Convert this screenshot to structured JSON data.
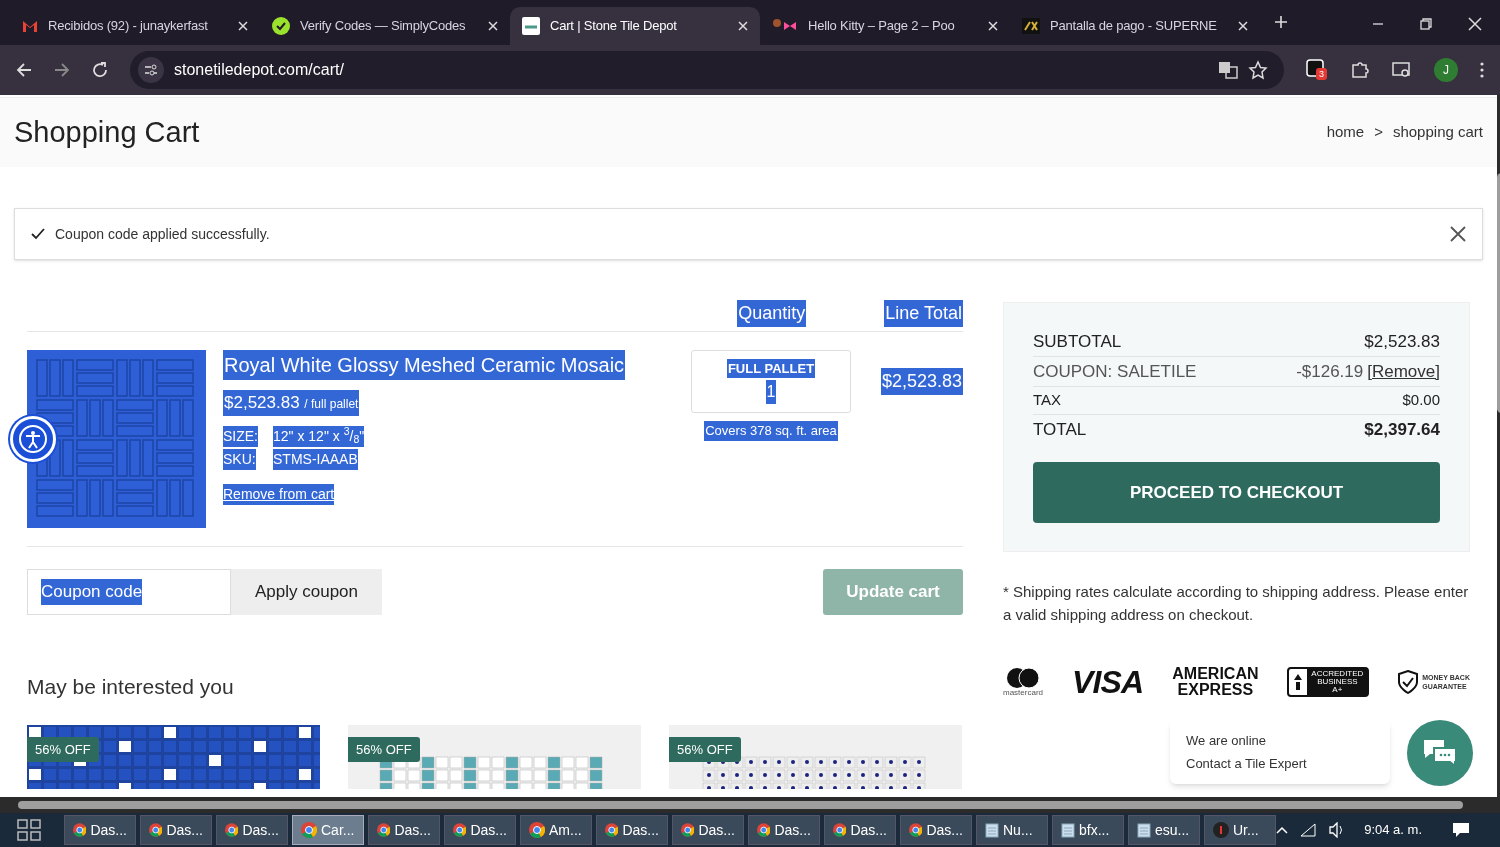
{
  "browser": {
    "tabs": [
      {
        "kind": "mail",
        "title": "Recibidos (92) - junaykerfast",
        "selected": false
      },
      {
        "kind": "check",
        "title": "Verify Codes — SimplyCodes",
        "selected": false
      },
      {
        "kind": "std",
        "title": "Cart | Stone Tile Depot",
        "selected": true
      },
      {
        "kind": "bow",
        "title": "Hello Kitty – Page 2 – Poo",
        "selected": false
      },
      {
        "kind": "sx",
        "title": "Pantalla de pago - SUPERNE",
        "selected": false
      }
    ],
    "url": "stonetiledepot.com/cart/",
    "extension_badge": "3",
    "profile_initial": "J"
  },
  "page": {
    "title": "Shopping Cart",
    "breadcrumb": [
      "home",
      ">",
      "shopping cart"
    ],
    "notice": "Coupon code applied successfully.",
    "cart": {
      "text_selected": true,
      "columns": [
        "Quantity",
        "Line Total"
      ],
      "item": {
        "name": "Royal White Glossy Meshed Ceramic Mosaic",
        "price": "$2,523.83",
        "unit": "/ full pallet",
        "size_label": "SIZE:",
        "size": "12\" x 12\" x $^{3}$/$_{8}$\"",
        "sku_label": "SKU:",
        "sku": "STMS-IAAAB",
        "remove": "Remove from cart",
        "qty_label": "FULL PALLET",
        "qty": "1",
        "coverage": "Covers 378 sq. ft. area",
        "line_total": "$2,523.83"
      },
      "coupon_placeholder": "Coupon code",
      "apply": "Apply coupon",
      "update": "Update cart",
      "update_disabled": true
    },
    "recommend": {
      "title": "May be interested you",
      "cards": [
        {
          "badge": "56% OFF",
          "kind": "blue"
        },
        {
          "badge": "56% OFF",
          "kind": "teal"
        },
        {
          "badge": "56% OFF",
          "kind": "dots"
        }
      ]
    },
    "summary": {
      "rows": [
        {
          "kind": "normal",
          "label": "SUBTOTAL",
          "value": "$2,523.83"
        },
        {
          "kind": "coupon",
          "label": "COUPON: SALETILE",
          "value": "-$126.19",
          "link": "[Remove]"
        },
        {
          "kind": "small",
          "label": "TAX",
          "value": "$0.00"
        },
        {
          "kind": "total",
          "label": "TOTAL",
          "value": "$2,397.64"
        }
      ],
      "checkout": "PROCEED TO CHECKOUT",
      "note": "* Shipping rates calculate according to shipping address. Please enter a valid shipping address on checkout.",
      "logos": {
        "mastercard": "mastercard",
        "visa": "VISA",
        "amex": [
          "AMERICAN",
          "EXPRESS"
        ],
        "bbb": [
          "ACCREDITED",
          "BUSINESS",
          "A+"
        ],
        "money_back": [
          "MONEY BACK",
          "GUARANTEE"
        ]
      }
    },
    "chat": {
      "line1": "We are online",
      "line2": "Contact a Tile Expert"
    }
  },
  "taskbar": {
    "items": [
      {
        "kind": "chrome",
        "label": "Das...",
        "selected": false
      },
      {
        "kind": "chrome",
        "label": "Das...",
        "selected": false
      },
      {
        "kind": "chrome",
        "label": "Das...",
        "selected": false
      },
      {
        "kind": "chrome",
        "label": "Car...",
        "selected": true
      },
      {
        "kind": "chrome",
        "label": "Das...",
        "selected": false
      },
      {
        "kind": "chrome",
        "label": "Das...",
        "selected": false
      },
      {
        "kind": "chrome",
        "label": "Am...",
        "selected": false
      },
      {
        "kind": "chrome",
        "label": "Das...",
        "selected": false
      },
      {
        "kind": "chrome",
        "label": "Das...",
        "selected": false
      },
      {
        "kind": "chrome",
        "label": "Das...",
        "selected": false
      },
      {
        "kind": "chrome",
        "label": "Das...",
        "selected": false
      },
      {
        "kind": "chrome",
        "label": "Das...",
        "selected": false
      },
      {
        "kind": "notepad",
        "label": "Nu...",
        "selected": false
      },
      {
        "kind": "notepad",
        "label": "bfx...",
        "selected": false
      },
      {
        "kind": "notepad",
        "label": "esu...",
        "selected": false
      },
      {
        "kind": "app",
        "label": "Ur...",
        "selected": false
      }
    ],
    "time": "9:04 a. m."
  }
}
